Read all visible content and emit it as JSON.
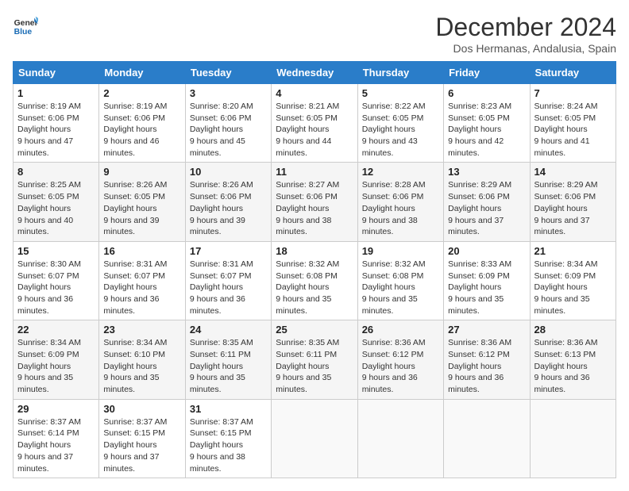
{
  "logo": {
    "line1": "General",
    "line2": "Blue"
  },
  "title": "December 2024",
  "subtitle": "Dos Hermanas, Andalusia, Spain",
  "weekdays": [
    "Sunday",
    "Monday",
    "Tuesday",
    "Wednesday",
    "Thursday",
    "Friday",
    "Saturday"
  ],
  "weeks": [
    [
      {
        "day": "1",
        "sunrise": "8:19 AM",
        "sunset": "6:06 PM",
        "daylight": "9 hours and 47 minutes."
      },
      {
        "day": "2",
        "sunrise": "8:19 AM",
        "sunset": "6:06 PM",
        "daylight": "9 hours and 46 minutes."
      },
      {
        "day": "3",
        "sunrise": "8:20 AM",
        "sunset": "6:06 PM",
        "daylight": "9 hours and 45 minutes."
      },
      {
        "day": "4",
        "sunrise": "8:21 AM",
        "sunset": "6:05 PM",
        "daylight": "9 hours and 44 minutes."
      },
      {
        "day": "5",
        "sunrise": "8:22 AM",
        "sunset": "6:05 PM",
        "daylight": "9 hours and 43 minutes."
      },
      {
        "day": "6",
        "sunrise": "8:23 AM",
        "sunset": "6:05 PM",
        "daylight": "9 hours and 42 minutes."
      },
      {
        "day": "7",
        "sunrise": "8:24 AM",
        "sunset": "6:05 PM",
        "daylight": "9 hours and 41 minutes."
      }
    ],
    [
      {
        "day": "8",
        "sunrise": "8:25 AM",
        "sunset": "6:05 PM",
        "daylight": "9 hours and 40 minutes."
      },
      {
        "day": "9",
        "sunrise": "8:26 AM",
        "sunset": "6:05 PM",
        "daylight": "9 hours and 39 minutes."
      },
      {
        "day": "10",
        "sunrise": "8:26 AM",
        "sunset": "6:06 PM",
        "daylight": "9 hours and 39 minutes."
      },
      {
        "day": "11",
        "sunrise": "8:27 AM",
        "sunset": "6:06 PM",
        "daylight": "9 hours and 38 minutes."
      },
      {
        "day": "12",
        "sunrise": "8:28 AM",
        "sunset": "6:06 PM",
        "daylight": "9 hours and 38 minutes."
      },
      {
        "day": "13",
        "sunrise": "8:29 AM",
        "sunset": "6:06 PM",
        "daylight": "9 hours and 37 minutes."
      },
      {
        "day": "14",
        "sunrise": "8:29 AM",
        "sunset": "6:06 PM",
        "daylight": "9 hours and 37 minutes."
      }
    ],
    [
      {
        "day": "15",
        "sunrise": "8:30 AM",
        "sunset": "6:07 PM",
        "daylight": "9 hours and 36 minutes."
      },
      {
        "day": "16",
        "sunrise": "8:31 AM",
        "sunset": "6:07 PM",
        "daylight": "9 hours and 36 minutes."
      },
      {
        "day": "17",
        "sunrise": "8:31 AM",
        "sunset": "6:07 PM",
        "daylight": "9 hours and 36 minutes."
      },
      {
        "day": "18",
        "sunrise": "8:32 AM",
        "sunset": "6:08 PM",
        "daylight": "9 hours and 35 minutes."
      },
      {
        "day": "19",
        "sunrise": "8:32 AM",
        "sunset": "6:08 PM",
        "daylight": "9 hours and 35 minutes."
      },
      {
        "day": "20",
        "sunrise": "8:33 AM",
        "sunset": "6:09 PM",
        "daylight": "9 hours and 35 minutes."
      },
      {
        "day": "21",
        "sunrise": "8:34 AM",
        "sunset": "6:09 PM",
        "daylight": "9 hours and 35 minutes."
      }
    ],
    [
      {
        "day": "22",
        "sunrise": "8:34 AM",
        "sunset": "6:09 PM",
        "daylight": "9 hours and 35 minutes."
      },
      {
        "day": "23",
        "sunrise": "8:34 AM",
        "sunset": "6:10 PM",
        "daylight": "9 hours and 35 minutes."
      },
      {
        "day": "24",
        "sunrise": "8:35 AM",
        "sunset": "6:11 PM",
        "daylight": "9 hours and 35 minutes."
      },
      {
        "day": "25",
        "sunrise": "8:35 AM",
        "sunset": "6:11 PM",
        "daylight": "9 hours and 35 minutes."
      },
      {
        "day": "26",
        "sunrise": "8:36 AM",
        "sunset": "6:12 PM",
        "daylight": "9 hours and 36 minutes."
      },
      {
        "day": "27",
        "sunrise": "8:36 AM",
        "sunset": "6:12 PM",
        "daylight": "9 hours and 36 minutes."
      },
      {
        "day": "28",
        "sunrise": "8:36 AM",
        "sunset": "6:13 PM",
        "daylight": "9 hours and 36 minutes."
      }
    ],
    [
      {
        "day": "29",
        "sunrise": "8:37 AM",
        "sunset": "6:14 PM",
        "daylight": "9 hours and 37 minutes."
      },
      {
        "day": "30",
        "sunrise": "8:37 AM",
        "sunset": "6:15 PM",
        "daylight": "9 hours and 37 minutes."
      },
      {
        "day": "31",
        "sunrise": "8:37 AM",
        "sunset": "6:15 PM",
        "daylight": "9 hours and 38 minutes."
      },
      null,
      null,
      null,
      null
    ]
  ],
  "labels": {
    "sunrise": "Sunrise:",
    "sunset": "Sunset:",
    "daylight": "Daylight hours"
  }
}
